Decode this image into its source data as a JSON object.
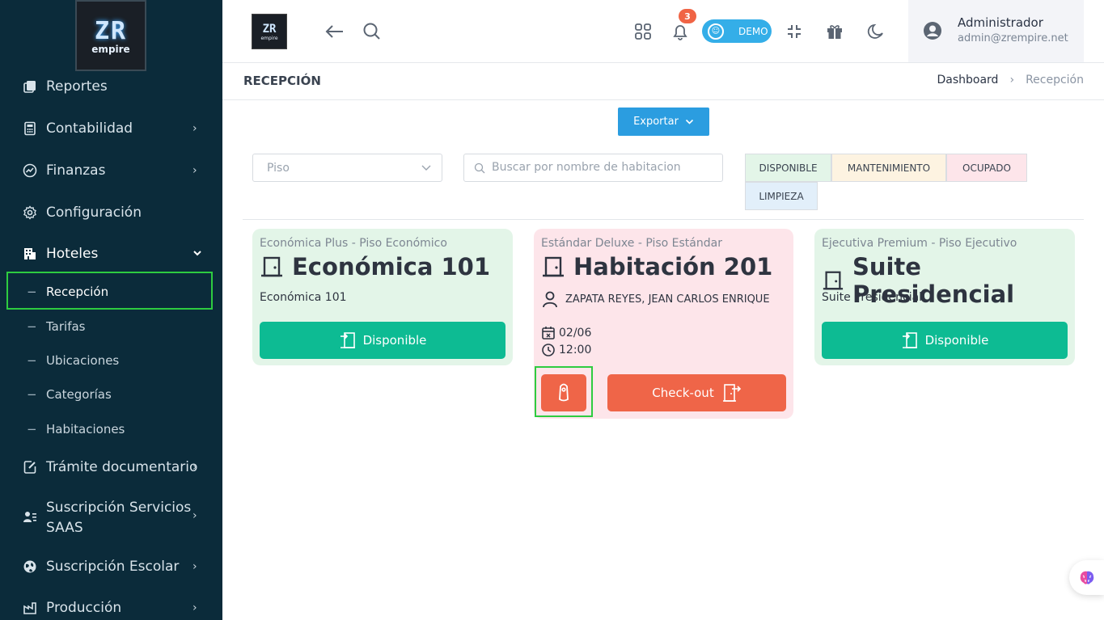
{
  "sidebar": {
    "logo": {
      "line1": "ZR",
      "line2": "empire"
    },
    "items": [
      {
        "label": "Reportes",
        "icon": "reports-icon",
        "chevron": ""
      },
      {
        "label": "Contabilidad",
        "icon": "calculator-icon",
        "chevron": "›"
      },
      {
        "label": "Finanzas",
        "icon": "chart-circle-icon",
        "chevron": "›"
      },
      {
        "label": "Configuración",
        "icon": "gear-icon",
        "chevron": ""
      },
      {
        "label": "Hoteles",
        "icon": "hotel-icon",
        "chevron": "⌄"
      },
      {
        "label": "Trámite documentario",
        "icon": "document-edit-icon",
        "chevron": "›"
      },
      {
        "label": "Suscripción Servicios",
        "label2": "SAAS",
        "icon": "user-list-icon",
        "chevron": "›"
      },
      {
        "label": "Suscripción Escolar",
        "icon": "globe-icon",
        "chevron": "›"
      },
      {
        "label": "Producción",
        "icon": "factory-icon",
        "chevron": "›"
      }
    ],
    "subitems": [
      {
        "label": "Recepción",
        "dash": "−"
      },
      {
        "label": "Tarifas",
        "dash": "−"
      },
      {
        "label": "Ubicaciones",
        "dash": "−"
      },
      {
        "label": "Categorías",
        "dash": "−"
      },
      {
        "label": "Habitaciones",
        "dash": "−"
      }
    ]
  },
  "topbar": {
    "logo": {
      "line1": "ZR",
      "line2": "empire"
    },
    "notification_count": "3",
    "demo_label": "DEMO",
    "user": {
      "name": "Administrador",
      "email": "admin@zrempire.net"
    }
  },
  "page": {
    "title": "RECEPCIÓN",
    "breadcrumb": {
      "home": "Dashboard",
      "separator": "›",
      "current": "Recepción"
    }
  },
  "toolbar": {
    "export_label": "Exportar",
    "floor_placeholder": "Piso",
    "search_placeholder": "Buscar por nombre de habitacion"
  },
  "legend": {
    "available": "DISPONIBLE",
    "maintenance": "MANTENIMIENTO",
    "occupied": "OCUPADO",
    "cleaning": "LIMPIEZA"
  },
  "colors": {
    "sidebar": "#0b2b3a",
    "available_bg": "#e3f5e8",
    "maintenance_bg": "#fdf3e1",
    "occupied_bg": "#fde5ea",
    "cleaning_bg": "#e2effa",
    "teal": "#0dbb93",
    "orange": "#ef6548",
    "accent_blue": "#2b9de0"
  },
  "rooms": [
    {
      "subtitle": "Económica Plus - Piso Económico",
      "title": "Económica 101",
      "description": "Económica 101",
      "status_label": "Disponible"
    },
    {
      "subtitle": "Estándar Deluxe - Piso Estándar",
      "title": "Habitación 201",
      "guest": "ZAPATA REYES, JEAN CARLOS ENRIQUE",
      "date": "02/06",
      "time": "12:00",
      "checkout_label": "Check-out"
    },
    {
      "subtitle": "Ejecutiva Premium - Piso Ejecutivo",
      "title": "Suite Presidencial",
      "description": "Suite Presidencial",
      "status_label": "Disponible"
    }
  ]
}
